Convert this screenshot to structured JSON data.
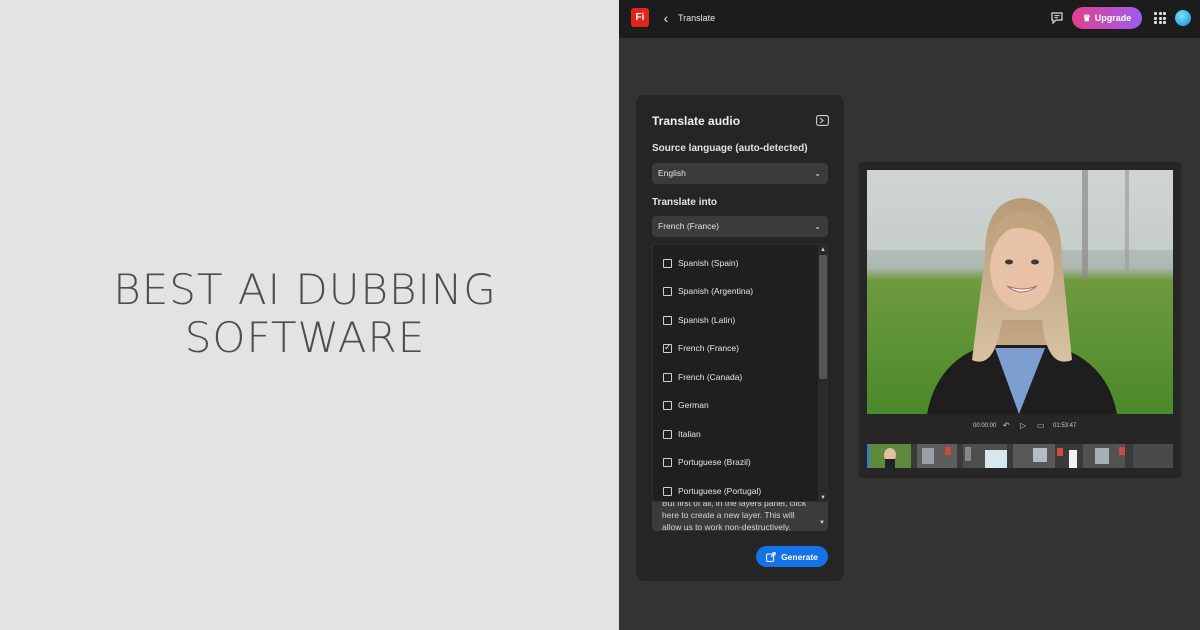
{
  "headline": {
    "line1": "BEST AI DUBBING",
    "line2": "SOFTWARE"
  },
  "topbar": {
    "logo_text": "Fi",
    "title": "Translate",
    "upgrade_label": "Upgrade",
    "icons": [
      "chevron-left-icon",
      "chat-icon",
      "crown-icon",
      "apps-grid-icon"
    ]
  },
  "panel": {
    "title": "Translate audio",
    "source_label": "Source language (auto-detected)",
    "source_value": "English",
    "target_label": "Translate into",
    "target_value": "French (France)",
    "options": [
      {
        "label": "Spanish (Spain)",
        "checked": false
      },
      {
        "label": "Spanish (Argentina)",
        "checked": false
      },
      {
        "label": "Spanish (Latin)",
        "checked": false
      },
      {
        "label": "French (France)",
        "checked": true
      },
      {
        "label": "French (Canada)",
        "checked": false
      },
      {
        "label": "German",
        "checked": false
      },
      {
        "label": "Italian",
        "checked": false
      },
      {
        "label": "Portuguese (Brazil)",
        "checked": false
      },
      {
        "label": "Portuguese (Portugal)",
        "checked": false
      }
    ],
    "transcript": "But first of all, in the layers panel, click here to create a new layer. This will allow us to work non-destructively.",
    "generate_label": "Generate"
  },
  "player": {
    "current_time": "00:00:00",
    "duration": "01:53:47"
  },
  "colors": {
    "accent": "#1473e6",
    "brand": "#e1251b",
    "upgrade_gradient": [
      "#e0408c",
      "#9c5cf0"
    ]
  }
}
